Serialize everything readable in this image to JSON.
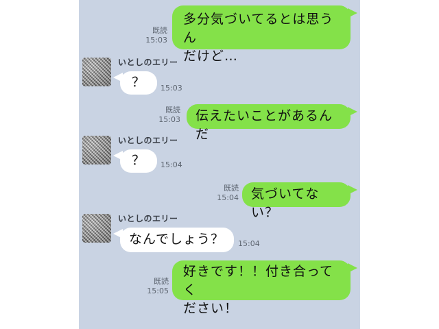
{
  "chat": {
    "read_label": "既読",
    "sender_name": "いとしのエリー",
    "messages": [
      {
        "dir": "out",
        "lines": [
          "多分気づいてるとは思うん",
          "だけど…"
        ],
        "time": "15:03"
      },
      {
        "dir": "in",
        "lines": [
          "？"
        ],
        "time": "15:03"
      },
      {
        "dir": "out",
        "lines": [
          "伝えたいことがあるんだ"
        ],
        "time": "15:03"
      },
      {
        "dir": "in",
        "lines": [
          "？"
        ],
        "time": "15:04"
      },
      {
        "dir": "out",
        "lines": [
          "気づいてない？"
        ],
        "time": "15:04"
      },
      {
        "dir": "in",
        "lines": [
          "なんでしょう？"
        ],
        "time": "15:04"
      },
      {
        "dir": "out",
        "lines": [
          "好きです！！付き合ってく",
          "ださい！"
        ],
        "time": "15:05"
      }
    ]
  },
  "colors": {
    "background": "#c9d3e3",
    "outgoing_bubble": "#84e149",
    "incoming_bubble": "#ffffff",
    "meta_text": "#5d6570"
  },
  "icons": {
    "avatar": "avatar-image"
  }
}
